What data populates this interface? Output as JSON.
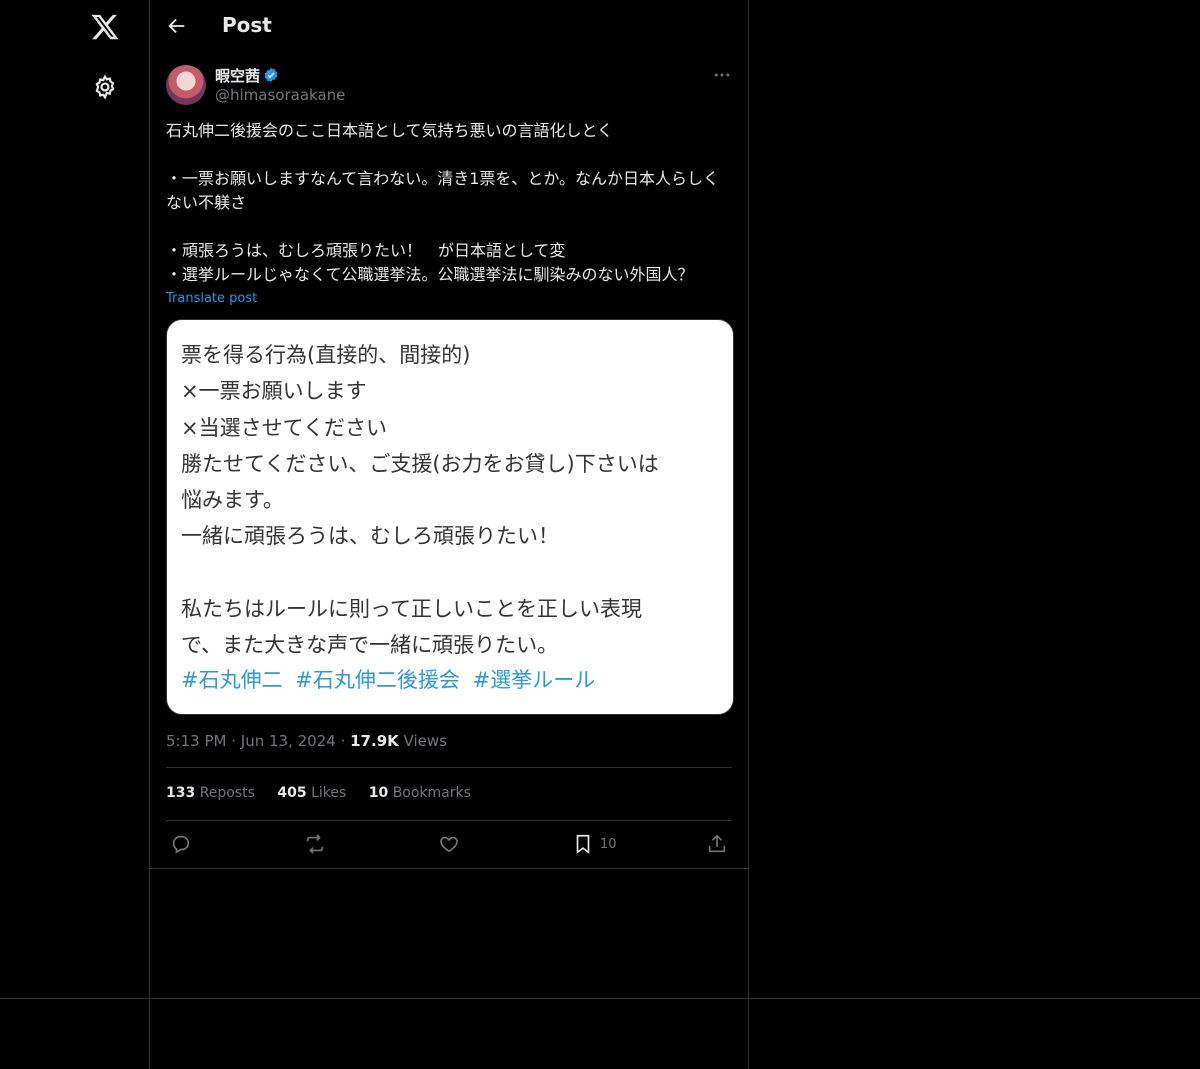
{
  "nav": {
    "x_logo_icon": "x-logo-icon",
    "settings_icon": "gear-icon"
  },
  "header": {
    "title": "Post"
  },
  "author": {
    "name": "暇空茜",
    "handle": "@himasoraakane",
    "verified_color": "#1d9bf0"
  },
  "post": {
    "text": "石丸伸二後援会のここ日本語として気持ち悪いの言語化しとく\n\n・一票お願いしますなんて言わない。清き1票を、とか。なんか日本人らしくない不躾さ\n\n・頑張ろうは、むしろ頑張りたい！　が日本語として変\n・選挙ルールじゃなくて公職選挙法。公職選挙法に馴染みのない外国人？",
    "translate_label": "Translate post"
  },
  "image": {
    "text": "票を得る行為(直接的、間接的)\n×一票お願いします\n×当選させてください\n勝たせてください、ご支援(お力をお貸し)下さいは\n悩みます。\n一緒に頑張ろうは、むしろ頑張りたい！\n\n私たちはルールに則って正しいことを正しい表現\nで、また大きな声で一緒に頑張りたい。",
    "hashtags": [
      "#石丸伸二",
      "#石丸伸二後援会",
      "#選挙ルール"
    ]
  },
  "meta": {
    "time": "5:13 PM",
    "date": "Jun 13, 2024",
    "views_count": "17.9K",
    "views_label": "Views"
  },
  "stats": {
    "reposts_count": "133",
    "reposts_label": "Reposts",
    "likes_count": "405",
    "likes_label": "Likes",
    "bookmarks_count": "10",
    "bookmarks_label": "Bookmarks"
  },
  "actions": {
    "bookmark_count": "10"
  },
  "colors": {
    "background": "#000000",
    "text": "#e7e9ea",
    "muted": "#71767b",
    "accent": "#1d9bf0",
    "border": "#2f3336"
  }
}
